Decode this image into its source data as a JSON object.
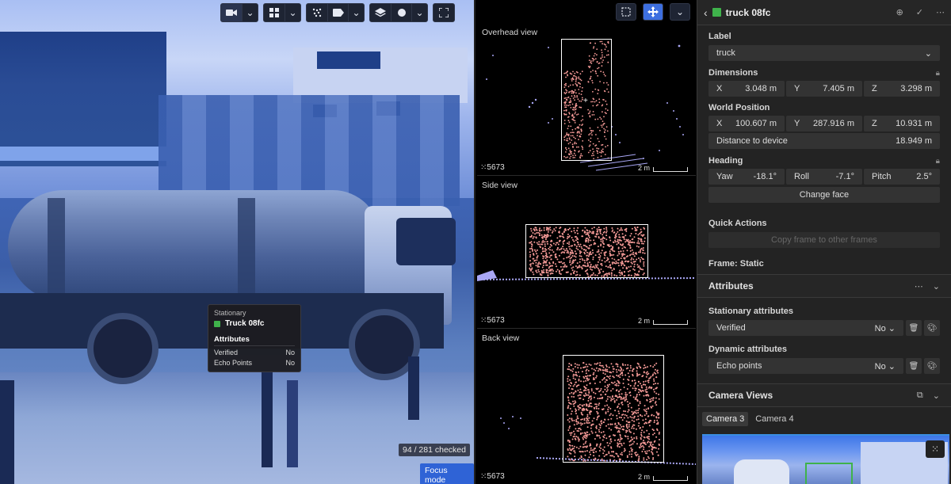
{
  "camera": {
    "tooltip": {
      "title": "Stationary",
      "object_name": "Truck 08fc",
      "section": "Attributes",
      "rows": [
        {
          "label": "Verified",
          "value": "No"
        },
        {
          "label": "Echo Points",
          "value": "No"
        }
      ]
    },
    "checked_badge": "94 / 281 checked",
    "focus_mode": "Focus mode"
  },
  "point_cloud": {
    "views": [
      {
        "title": "Overhead view",
        "count": "5673",
        "scale": "2 m"
      },
      {
        "title": "Side view",
        "count": "5673",
        "scale": "2 m"
      },
      {
        "title": "Back view",
        "count": "5673",
        "scale": "2 m"
      }
    ]
  },
  "panel": {
    "object_title": "truck 08fc",
    "label_heading": "Label",
    "label_value": "truck",
    "dimensions_heading": "Dimensions",
    "dimensions": [
      {
        "axis": "X",
        "value": "3.048 m"
      },
      {
        "axis": "Y",
        "value": "7.405 m"
      },
      {
        "axis": "Z",
        "value": "3.298 m"
      }
    ],
    "world_position_heading": "World Position",
    "world_position": [
      {
        "axis": "X",
        "value": "100.607 m"
      },
      {
        "axis": "Y",
        "value": "287.916 m"
      },
      {
        "axis": "Z",
        "value": "10.931 m"
      }
    ],
    "distance_label": "Distance to device",
    "distance_value": "18.949 m",
    "heading_heading": "Heading",
    "heading": [
      {
        "axis": "Yaw",
        "value": "-18.1°"
      },
      {
        "axis": "Roll",
        "value": "-7.1°"
      },
      {
        "axis": "Pitch",
        "value": "2.5°"
      }
    ],
    "change_face": "Change face",
    "quick_actions_heading": "Quick Actions",
    "copy_frame": "Copy frame to other frames",
    "frame_status": "Frame: Static",
    "attributes_heading": "Attributes",
    "stationary_heading": "Stationary attributes",
    "stationary_attr": {
      "label": "Verified",
      "value": "No"
    },
    "dynamic_heading": "Dynamic attributes",
    "dynamic_attr": {
      "label": "Echo points",
      "value": "No"
    },
    "camera_views_heading": "Camera Views",
    "camera_tabs": [
      "Camera 3",
      "Camera 4"
    ]
  },
  "colors": {
    "accent": "#3d6fe0",
    "object_green": "#3fb24b",
    "points": "#f49a97",
    "ground_points": "#a9a7f5"
  }
}
